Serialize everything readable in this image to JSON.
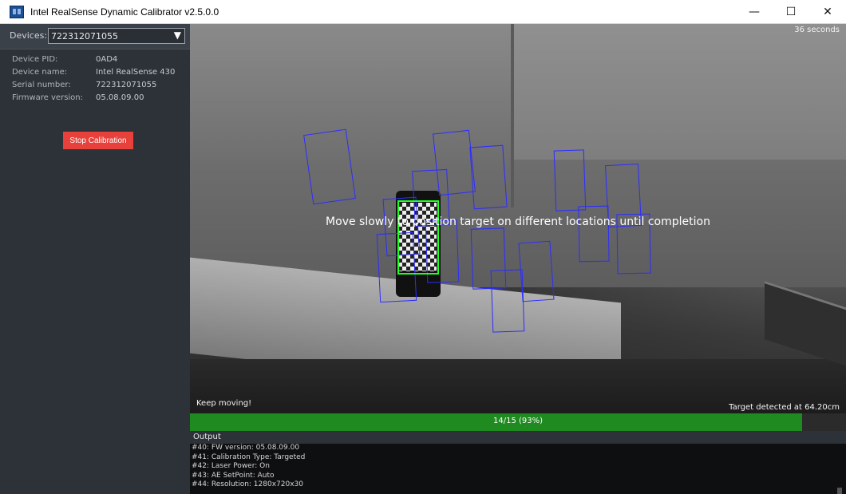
{
  "window": {
    "title": "Intel RealSense Dynamic Calibrator v2.5.0.0",
    "controls": {
      "minimize": "—",
      "maximize": "☐",
      "close": "✕"
    }
  },
  "sidebar": {
    "devices_label": "Devices:",
    "device_selected": "722312071055",
    "info": [
      {
        "key": "Device PID:",
        "value": "0AD4"
      },
      {
        "key": "Device name:",
        "value": "Intel RealSense 430"
      },
      {
        "key": "Serial number:",
        "value": "722312071055"
      },
      {
        "key": "Firmware version:",
        "value": "05.08.09.00"
      }
    ],
    "stop_button": "Stop Calibration"
  },
  "camera": {
    "timer": "36 seconds",
    "instruction": "Move slowly to position target on different locations until completion",
    "status_left": "Keep moving!",
    "status_right": "Target detected at 64.20cm"
  },
  "progress": {
    "label": "14/15 (93%)",
    "fraction": 0.933
  },
  "output": {
    "title": "Output",
    "lines": [
      "#40: FW version: 05.08.09.00",
      "#41: Calibration Type: Targeted",
      "#42: Laser Power: On",
      "#43: AE SetPoint: Auto",
      "#44: Resolution: 1280x720x30"
    ]
  },
  "colors": {
    "accent_stop": "#e8413c",
    "progress_fill": "#1f8a1f",
    "target_outline": "#2d2dff",
    "detected_outline": "#22ff22"
  }
}
